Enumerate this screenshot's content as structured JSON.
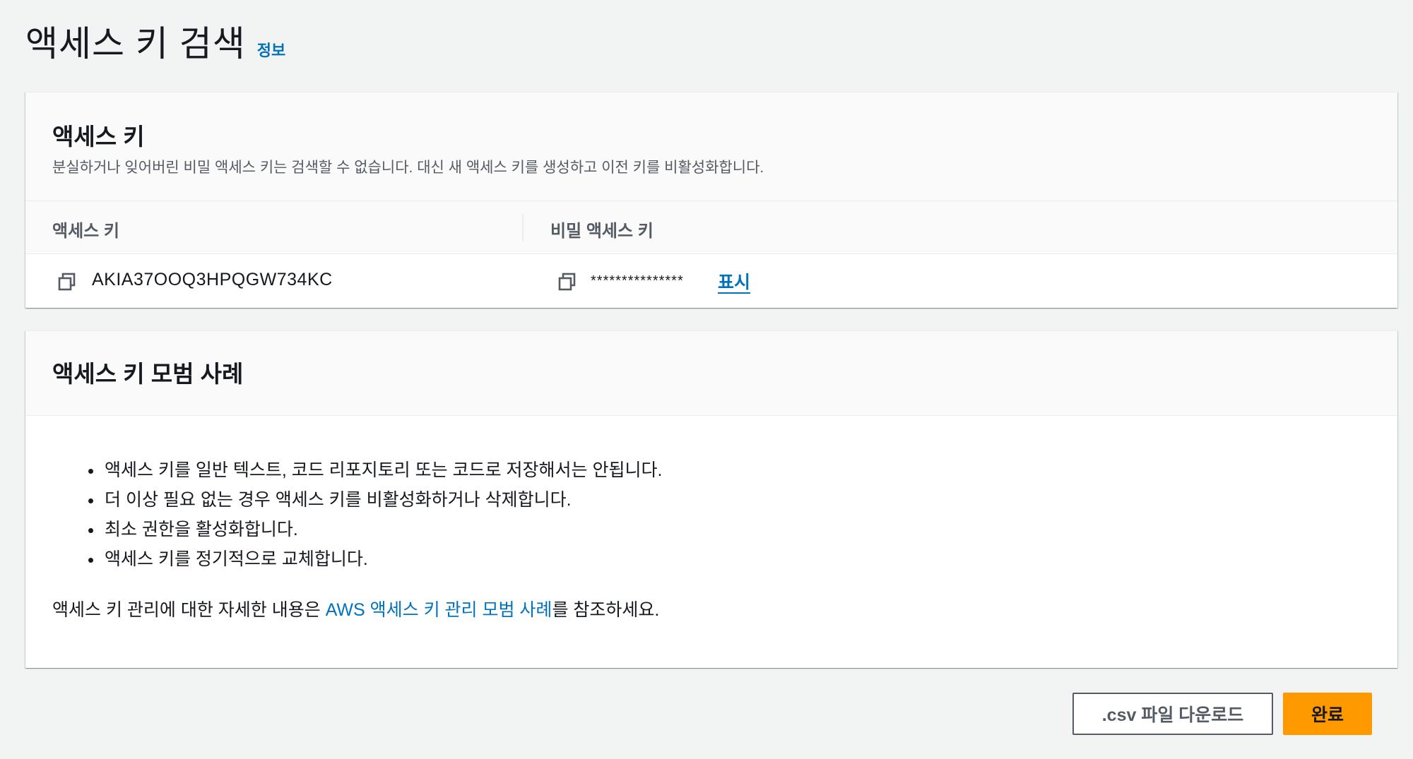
{
  "header": {
    "title": "액세스 키 검색",
    "info_link": "정보"
  },
  "access_key_card": {
    "title": "액세스 키",
    "description": "분실하거나 잊어버린 비밀 액세스 키는 검색할 수 없습니다. 대신 새 액세스 키를 생성하고 이전 키를 비활성화합니다.",
    "columns": [
      "액세스 키",
      "비밀 액세스 키"
    ],
    "row": {
      "access_key": "AKIA37OOQ3HPQGW734KC",
      "secret_masked": "***************",
      "show_label": "표시"
    },
    "icons": {
      "copy": "copy-icon"
    }
  },
  "best_practices_card": {
    "title": "액세스 키 모범 사례",
    "items": [
      "액세스 키를 일반 텍스트, 코드 리포지토리 또는 코드로 저장해서는 안됩니다.",
      "더 이상 필요 없는 경우 액세스 키를 비활성화하거나 삭제합니다.",
      "최소 권한을 활성화합니다.",
      "액세스 키를 정기적으로 교체합니다."
    ],
    "note_prefix": "액세스 키 관리에 대한 자세한 내용은 ",
    "note_link": "AWS 액세스 키 관리 모범 사례",
    "note_suffix": "를 참조하세요."
  },
  "actions": {
    "download_csv": ".csv 파일 다운로드",
    "done": "완료"
  },
  "colors": {
    "link": "#0073bb",
    "primary_button": "#ff9900",
    "page_background": "#f2f3f3"
  }
}
